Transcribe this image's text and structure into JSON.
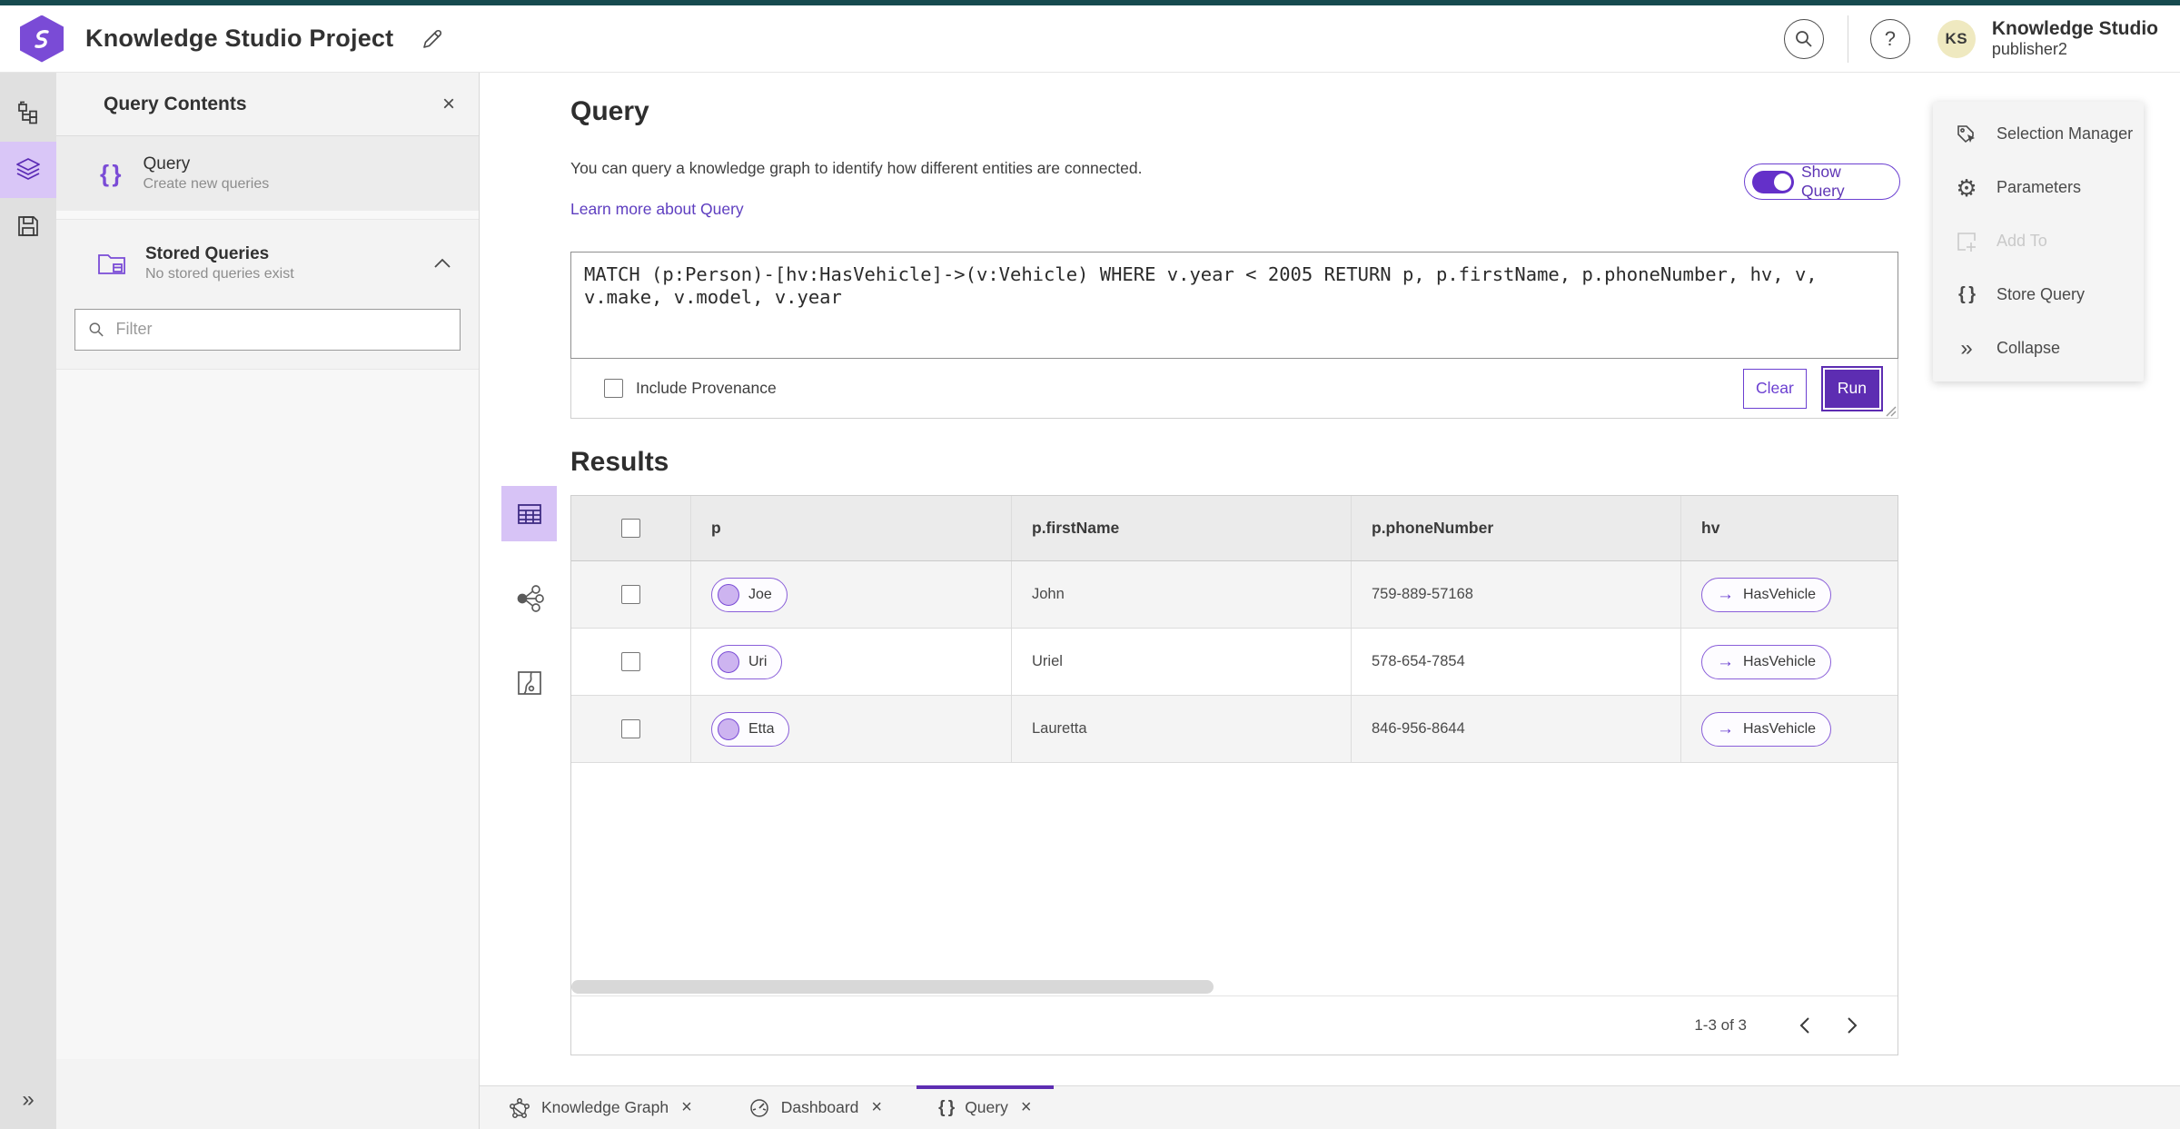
{
  "header": {
    "app_title": "Knowledge Studio Project",
    "user_name": "Knowledge Studio",
    "user_role": "publisher2",
    "avatar_initials": "KS"
  },
  "contents": {
    "title": "Query Contents",
    "query_item": {
      "title": "Query",
      "subtitle": "Create new queries"
    },
    "stored": {
      "title": "Stored Queries",
      "subtitle": "No stored queries exist"
    },
    "filter_placeholder": "Filter"
  },
  "query": {
    "title": "Query",
    "description": "You can query a knowledge graph to identify how different entities are connected.",
    "learn_more": "Learn more about Query",
    "show_query": "Show Query",
    "text": "MATCH (p:Person)-[hv:HasVehicle]->(v:Vehicle) WHERE v.year < 2005 RETURN p, p.firstName, p.phoneNumber, hv, v, v.make, v.model, v.year",
    "include_provenance": "Include Provenance",
    "clear": "Clear",
    "run": "Run"
  },
  "results": {
    "title": "Results",
    "columns": [
      "p",
      "p.firstName",
      "p.phoneNumber",
      "hv"
    ],
    "rows": [
      {
        "entity": "Joe",
        "first_name": "John",
        "phone": "759-889-57168",
        "relationship": "HasVehicle"
      },
      {
        "entity": "Uri",
        "first_name": "Uriel",
        "phone": "578-654-7854",
        "relationship": "HasVehicle"
      },
      {
        "entity": "Etta",
        "first_name": "Lauretta",
        "phone": "846-956-8644",
        "relationship": "HasVehicle"
      }
    ],
    "pagination": "1-3 of 3"
  },
  "tools": {
    "items": [
      {
        "label": "Selection Manager",
        "disabled": false
      },
      {
        "label": "Parameters",
        "disabled": false
      },
      {
        "label": "Add To",
        "disabled": true
      },
      {
        "label": "Store Query",
        "disabled": false
      },
      {
        "label": "Collapse",
        "disabled": false
      }
    ]
  },
  "tabs": {
    "items": [
      {
        "label": "Knowledge Graph",
        "active": false
      },
      {
        "label": "Dashboard",
        "active": false
      },
      {
        "label": "Query",
        "active": true
      }
    ]
  },
  "icons": {
    "close": "×",
    "help": "?",
    "braces": "{ }",
    "arrow_right": "→",
    "gear": "⚙",
    "collapse_right": "»",
    "expand_right": "»"
  },
  "colors": {
    "accent": "#5d2db2",
    "accent_light": "#8a5fd9",
    "teal_strip": "#164a4f",
    "rail_selected": "#d9c6f7",
    "avatar_bg": "#efe9c0"
  }
}
